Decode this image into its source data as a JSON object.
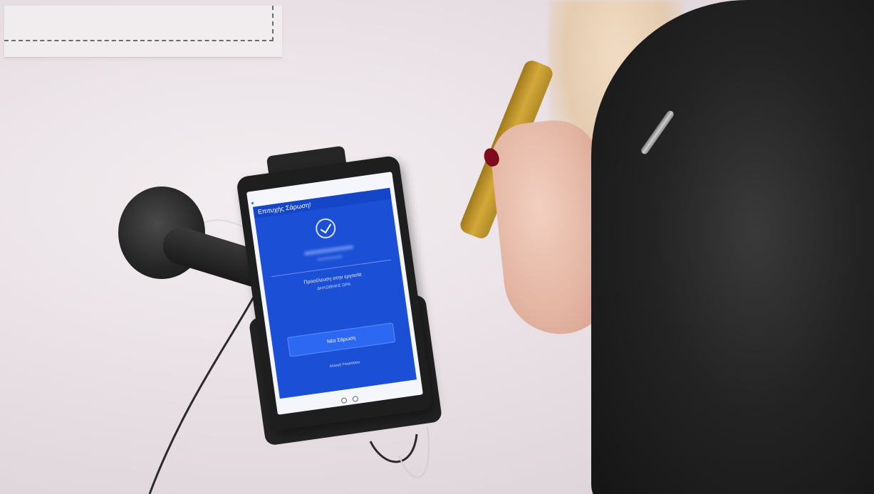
{
  "tablet": {
    "header": "Επιτυχής Σάρωση!",
    "message": "Προσέλευση στην εργασία",
    "message_sub": "ΔΗΛΩΘΗΚΕ ΩΡΑ",
    "button": "Νέα Σάρωση",
    "link": "Αλλαγή Υπαλλήλου"
  },
  "colors": {
    "screen_blue": "#1a4fd6",
    "button_blue": "#2c68f2",
    "wall": "#e9e2e6",
    "jacket": "#1b1b1b",
    "phone": "#c79a30"
  }
}
